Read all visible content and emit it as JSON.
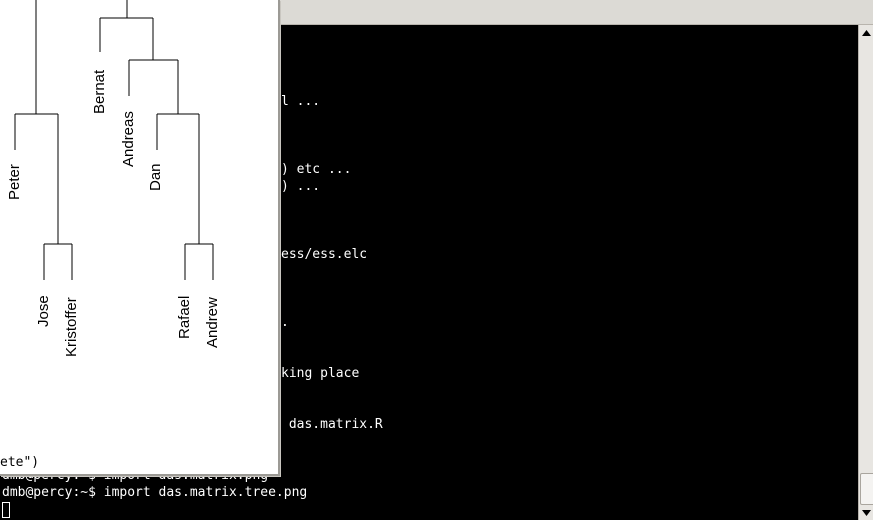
{
  "terminal": {
    "partial_lines": [
      "l ...",
      ") etc ...",
      ") ...",
      "ess/ess.elc",
      ".",
      "king place",
      " das.matrix.R"
    ],
    "prompt_line_hidden": "dmb@percy:~$ import das.matrix.png",
    "prompt_line": "dmb@percy:~$ import das.matrix.tree.png"
  },
  "plot_window": {
    "caption": "ete\")",
    "leaf_labels": [
      "Peter",
      "Jose",
      "Kristoffer",
      "Bernat",
      "Andreas",
      "Dan",
      "Rafael",
      "Andrew"
    ]
  },
  "scrollbar": {
    "up_icon": "arrow-up-icon",
    "down_icon": "arrow-down-icon"
  }
}
